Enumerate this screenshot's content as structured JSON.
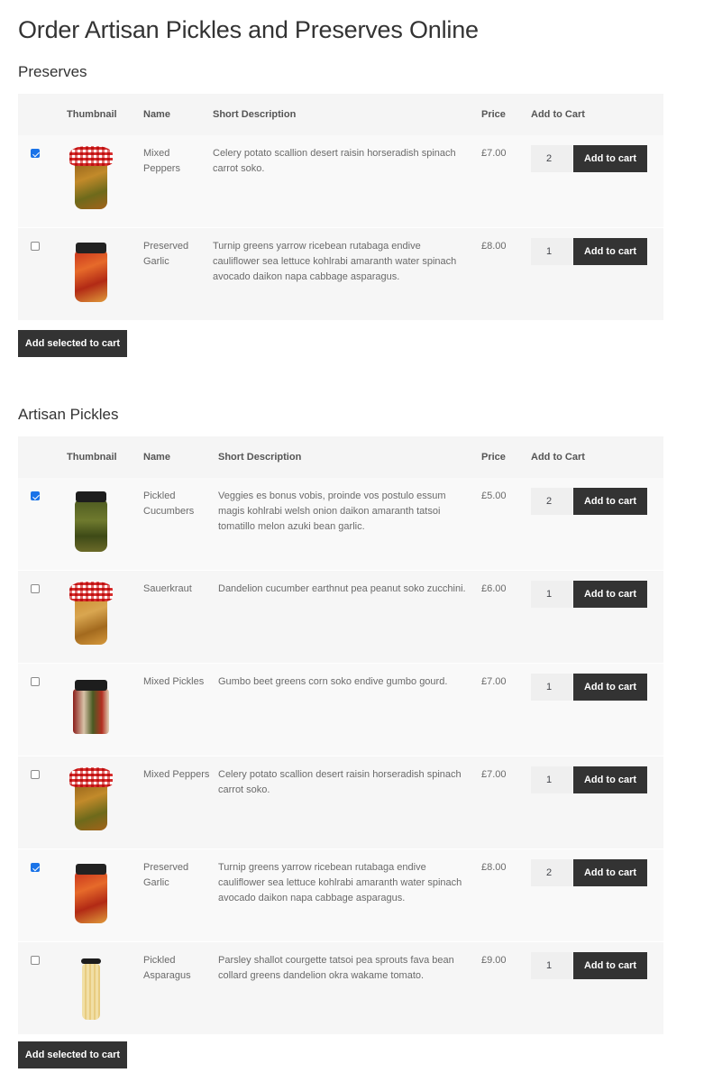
{
  "page_title": "Order Artisan Pickles and Preserves Online",
  "columns": {
    "thumbnail": "Thumbnail",
    "name": "Name",
    "short_description": "Short Description",
    "price": "Price",
    "add_to_cart": "Add to Cart"
  },
  "add_to_cart_label": "Add to cart",
  "add_selected_label": "Add selected to cart",
  "sections": [
    {
      "title": "Preserves",
      "products": [
        {
          "selected": true,
          "thumbnail": "mixed-peppers-jar",
          "name": "Mixed Peppers",
          "description": "Celery potato scallion desert raisin horseradish spinach carrot soko.",
          "price": "£7.00",
          "qty": "2"
        },
        {
          "selected": false,
          "thumbnail": "preserved-garlic-jar",
          "name": "Preserved Garlic",
          "description": "Turnip greens yarrow ricebean rutabaga endive cauliflower sea lettuce kohlrabi amaranth water spinach avocado daikon napa cabbage asparagus.",
          "price": "£8.00",
          "qty": "1"
        }
      ]
    },
    {
      "title": "Artisan Pickles",
      "products": [
        {
          "selected": true,
          "thumbnail": "pickled-cucumbers-jar",
          "name": "Pickled Cucumbers",
          "description": "Veggies es bonus vobis, proinde vos postulo essum magis kohlrabi welsh onion daikon amaranth tatsoi tomatillo melon azuki bean garlic.",
          "price": "£5.00",
          "qty": "2"
        },
        {
          "selected": false,
          "thumbnail": "sauerkraut-jar",
          "name": "Sauerkraut",
          "description": "Dandelion cucumber earthnut pea peanut soko zucchini.",
          "price": "£6.00",
          "qty": "1"
        },
        {
          "selected": false,
          "thumbnail": "mixed-pickles-jar",
          "name": "Mixed Pickles",
          "description": "Gumbo beet greens corn soko endive gumbo gourd.",
          "price": "£7.00",
          "qty": "1"
        },
        {
          "selected": false,
          "thumbnail": "mixed-peppers-jar",
          "name": "Mixed Peppers",
          "description": "Celery potato scallion desert raisin horseradish spinach carrot soko.",
          "price": "£7.00",
          "qty": "1"
        },
        {
          "selected": true,
          "thumbnail": "preserved-garlic-jar",
          "name": "Preserved Garlic",
          "description": "Turnip greens yarrow ricebean rutabaga endive cauliflower sea lettuce kohlrabi amaranth water spinach avocado daikon napa cabbage asparagus.",
          "price": "£8.00",
          "qty": "2"
        },
        {
          "selected": false,
          "thumbnail": "pickled-asparagus-jar",
          "name": "Pickled Asparagus",
          "description": "Parsley shallot courgette tatsoi pea sprouts fava bean collard greens dandelion okra wakame tomato.",
          "price": "£9.00",
          "qty": "1"
        }
      ]
    }
  ]
}
